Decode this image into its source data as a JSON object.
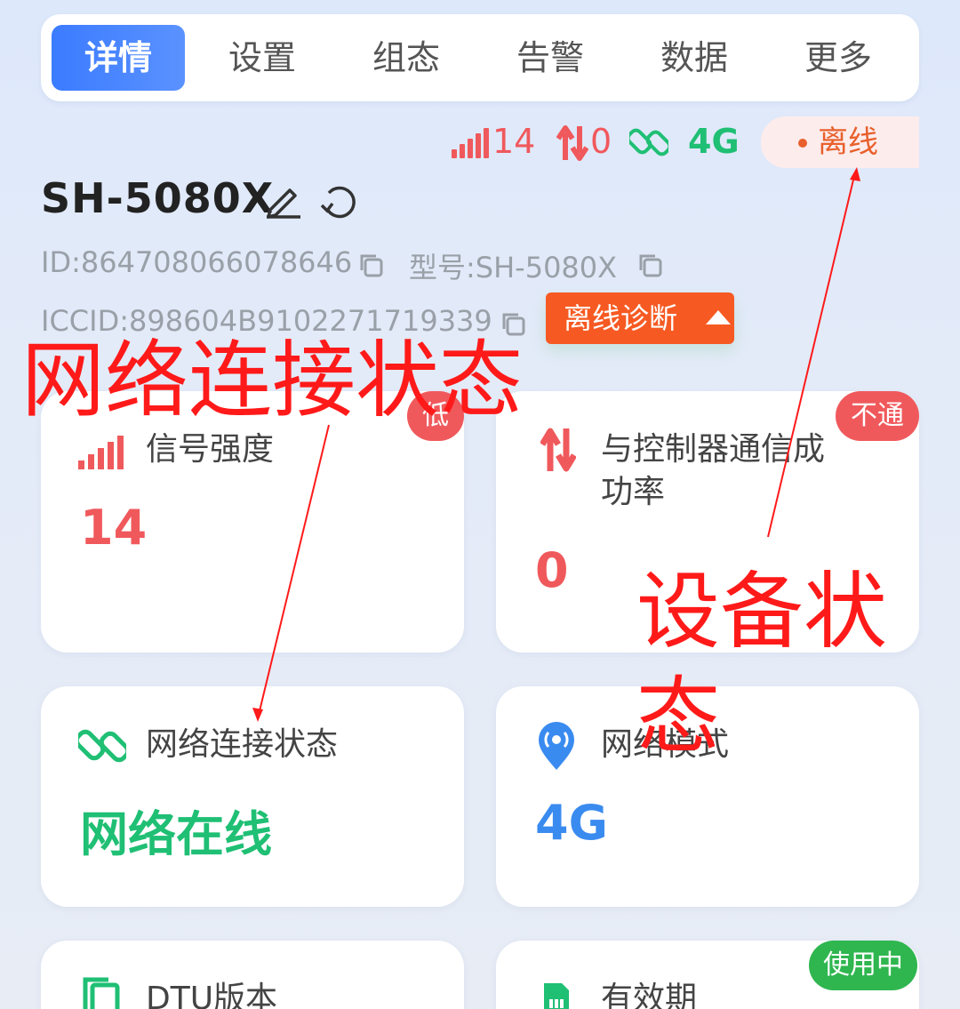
{
  "tabs": [
    "详情",
    "设置",
    "组态",
    "告警",
    "数据",
    "更多"
  ],
  "status": {
    "signal": "14",
    "traffic": "0",
    "net": "4G",
    "state": "离线"
  },
  "device": {
    "name": "SH-5080X",
    "id": "ID:864708066078646",
    "model": "型号:SH-5080X",
    "iccid": "ICCID:898604B9102271719339",
    "diagnose_label": "离线诊断"
  },
  "cards": {
    "signal": {
      "title": "信号强度",
      "value": "14",
      "badge": "低"
    },
    "comm": {
      "title_line1": "与控制器通信成",
      "title_line2": "功率",
      "value": "0",
      "badge": "不通"
    },
    "network": {
      "title": "网络连接状态",
      "value": "网络在线"
    },
    "mode": {
      "title": "网络模式",
      "value": "4G"
    },
    "dtu": {
      "title": "DTU版本"
    },
    "validity": {
      "title": "有效期",
      "badge": "使用中"
    }
  },
  "annotations": {
    "network_status": "网络连接状态",
    "device_status_line1": "设备状",
    "device_status_line2": "态"
  },
  "colors": {
    "accent_blue": "#3b7bff",
    "red": "#f0595c",
    "green": "#1fbf74",
    "orange": "#f65a22",
    "annotation_red": "#ff1a1a"
  }
}
